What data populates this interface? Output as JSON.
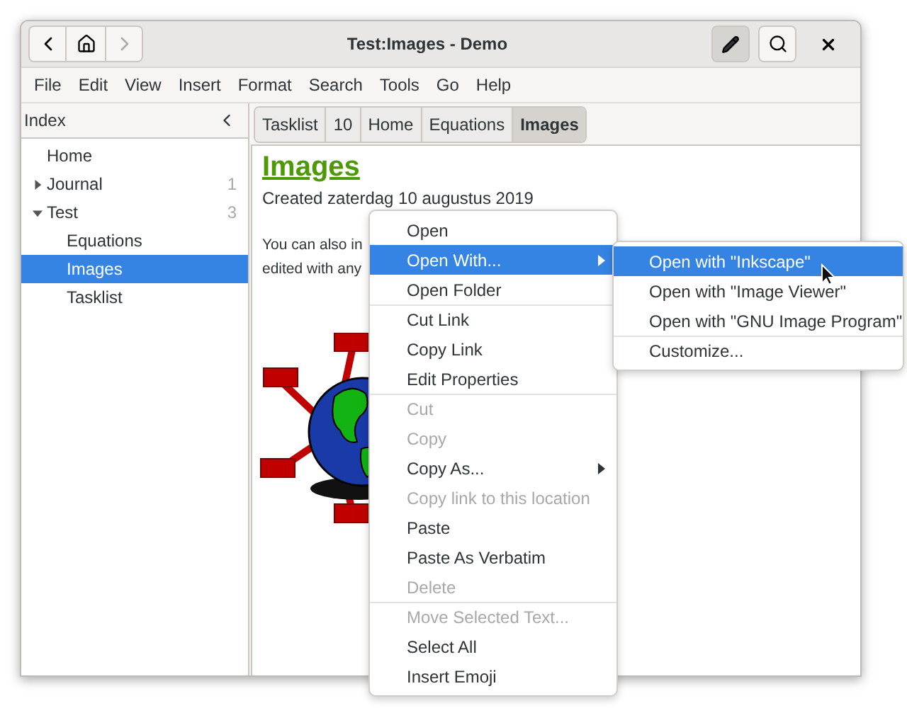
{
  "window": {
    "title": "Test:Images - Demo"
  },
  "menubar": [
    "File",
    "Edit",
    "View",
    "Insert",
    "Format",
    "Search",
    "Tools",
    "Go",
    "Help"
  ],
  "sidebar": {
    "title": "Index",
    "items": [
      {
        "label": "Home",
        "selected": false
      },
      {
        "label": "Journal",
        "count": "1",
        "expanded": false,
        "selected": false
      },
      {
        "label": "Test",
        "count": "3",
        "expanded": true,
        "selected": false,
        "children": [
          {
            "label": "Equations",
            "selected": false
          },
          {
            "label": "Images",
            "selected": true
          },
          {
            "label": "Tasklist",
            "selected": false
          }
        ]
      }
    ]
  },
  "pathbar": [
    {
      "label": "Tasklist",
      "selected": false
    },
    {
      "label": "10",
      "selected": false
    },
    {
      "label": "Home",
      "selected": false
    },
    {
      "label": "Equations",
      "selected": false
    },
    {
      "label": "Images",
      "selected": true
    }
  ],
  "page": {
    "title": "Images",
    "created": "Created zaterdag 10 augustus 2019",
    "lines": [
      "You can also in",
      "edited with any"
    ],
    "image": {
      "kind": "picture"
    }
  },
  "context_menu": [
    {
      "label": "Open",
      "disabled": false,
      "submenu": false,
      "selected": false,
      "separator_before": false
    },
    {
      "label": "Open With...",
      "disabled": false,
      "submenu": true,
      "selected": true,
      "separator_before": false
    },
    {
      "label": "Open Folder",
      "disabled": false,
      "submenu": false,
      "selected": false,
      "separator_before": false
    },
    {
      "label": "Cut Link",
      "disabled": false,
      "submenu": false,
      "selected": false,
      "separator_before": true
    },
    {
      "label": "Copy Link",
      "disabled": false,
      "submenu": false,
      "selected": false,
      "separator_before": false
    },
    {
      "label": "Edit Properties",
      "disabled": false,
      "submenu": false,
      "selected": false,
      "separator_before": false
    },
    {
      "label": "Cut",
      "disabled": true,
      "submenu": false,
      "selected": false,
      "separator_before": true
    },
    {
      "label": "Copy",
      "disabled": true,
      "submenu": false,
      "selected": false,
      "separator_before": false
    },
    {
      "label": "Copy As...",
      "disabled": false,
      "submenu": true,
      "selected": false,
      "separator_before": false
    },
    {
      "label": "Copy link to this location",
      "disabled": true,
      "submenu": false,
      "selected": false,
      "separator_before": false
    },
    {
      "label": "Paste",
      "disabled": false,
      "submenu": false,
      "selected": false,
      "separator_before": false
    },
    {
      "label": "Paste As Verbatim",
      "disabled": false,
      "submenu": false,
      "selected": false,
      "separator_before": false
    },
    {
      "label": "Delete",
      "disabled": true,
      "submenu": false,
      "selected": false,
      "separator_before": false
    },
    {
      "label": "Move Selected Text...",
      "disabled": true,
      "submenu": false,
      "selected": false,
      "separator_before": true
    },
    {
      "label": "Select All",
      "disabled": false,
      "submenu": false,
      "selected": false,
      "separator_before": false
    },
    {
      "label": "Insert Emoji",
      "disabled": false,
      "submenu": false,
      "selected": false,
      "separator_before": false
    }
  ],
  "submenu": [
    {
      "label": "Open with \"Inkscape\"",
      "selected": true,
      "separator_before": false
    },
    {
      "label": "Open with \"Image Viewer\"",
      "selected": false,
      "separator_before": false
    },
    {
      "label": "Open with \"GNU Image Program\"",
      "selected": false,
      "separator_before": false
    },
    {
      "label": "Customize...",
      "selected": false,
      "separator_before": true
    }
  ]
}
